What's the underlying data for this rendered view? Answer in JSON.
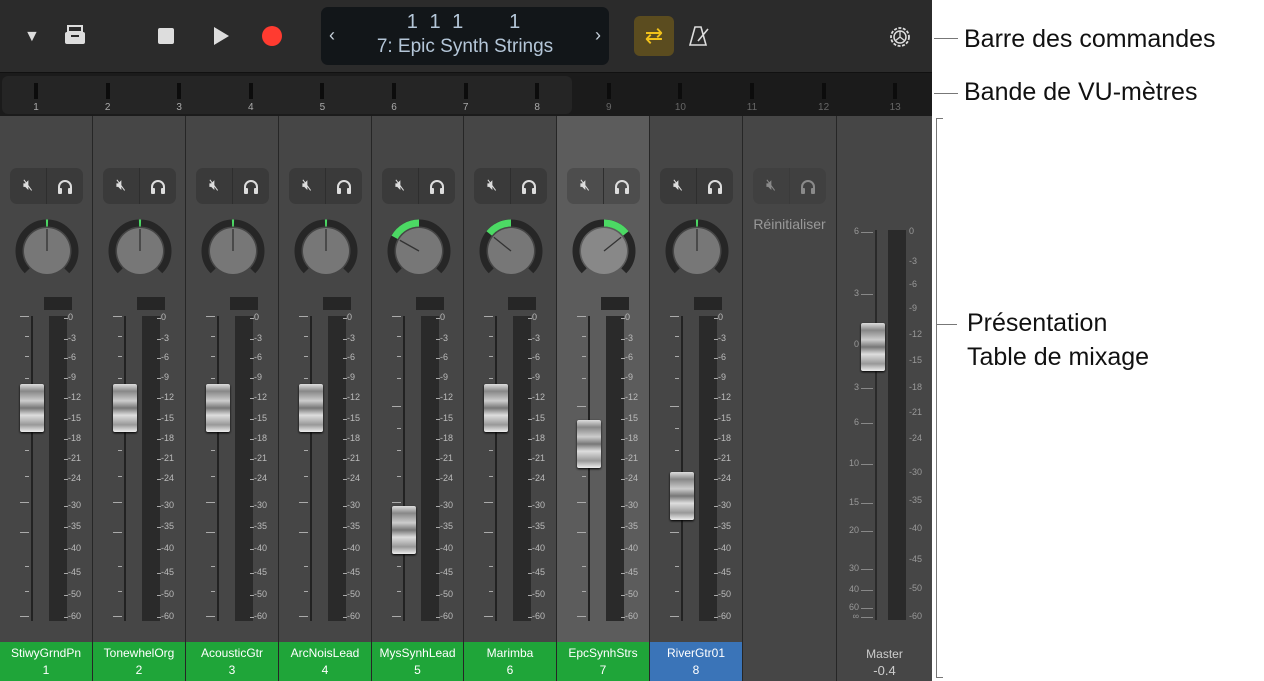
{
  "toolbar": {
    "icons": [
      "triangle-down-icon",
      "inbox-tray-icon",
      "stop-icon",
      "play-icon",
      "record-icon",
      "cycle-icon",
      "metronome-icon",
      "gear-icon"
    ],
    "lcd_position": "1 1 1     1",
    "lcd_track": "7: Epic Synth Strings",
    "lcd_prev": "‹",
    "lcd_next": "›",
    "record_color": "#ff3b30",
    "cycle_color": "#f2c21a"
  },
  "vu_strip": {
    "numbers": [
      "1",
      "2",
      "3",
      "4",
      "5",
      "6",
      "7",
      "8",
      "9",
      "10",
      "11",
      "12",
      "13"
    ],
    "visible_range": [
      1,
      8
    ]
  },
  "meter_scale": [
    "0",
    "3",
    "6",
    "9",
    "12",
    "15",
    "18",
    "21",
    "24",
    "30",
    "35",
    "40",
    "45",
    "50",
    "60"
  ],
  "channels": [
    {
      "name": "StiwyGrndPn",
      "number": "1",
      "pan": 0,
      "fader": 0.7,
      "color": "#1fa539"
    },
    {
      "name": "TonewhelOrg",
      "number": "2",
      "pan": 0,
      "fader": 0.7,
      "color": "#1fa539"
    },
    {
      "name": "AcousticGtr",
      "number": "3",
      "pan": 0,
      "fader": 0.7,
      "color": "#1fa539"
    },
    {
      "name": "ArcNoisLead",
      "number": "4",
      "pan": 0,
      "fader": 0.7,
      "color": "#1fa539"
    },
    {
      "name": "MysSynhLead",
      "number": "5",
      "pan": -0.45,
      "fader": 0.3,
      "color": "#1fa539"
    },
    {
      "name": "Marimba",
      "number": "6",
      "pan": -0.38,
      "fader": 0.7,
      "color": "#1fa539"
    },
    {
      "name": "EpcSynhStrs",
      "number": "7",
      "pan": 0.38,
      "fader": 0.58,
      "color": "#1fa539",
      "selected": true
    },
    {
      "name": "RiverGtr01",
      "number": "8",
      "pan": 0,
      "fader": 0.41,
      "color": "#3a74b8"
    }
  ],
  "reset_label": "Réinitialiser",
  "master": {
    "name": "Master",
    "value": "-0.4",
    "fader": 0.7,
    "fader_scale": [
      "6",
      "3",
      "0",
      "3",
      "6",
      "10",
      "15",
      "20",
      "30",
      "40",
      "60",
      "∞"
    ],
    "meter_scale": [
      "0",
      "3",
      "6",
      "9",
      "12",
      "15",
      "18",
      "21",
      "24",
      "30",
      "35",
      "40",
      "45",
      "50",
      "60"
    ]
  },
  "annotations": [
    "Barre des commandes",
    "Bande de VU-mètres",
    "Présentation",
    "Table de mixage"
  ]
}
